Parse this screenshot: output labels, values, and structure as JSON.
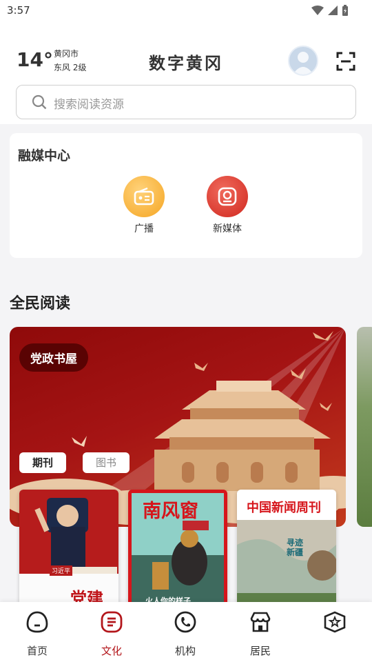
{
  "status": {
    "time": "3:57"
  },
  "header": {
    "temperature": "14°",
    "city": "黄冈市",
    "wind": "东风 2级",
    "app_title": "数字黄冈"
  },
  "search": {
    "placeholder": "搜索阅读资源"
  },
  "media_center": {
    "title": "融媒中心",
    "items": [
      {
        "label": "广播",
        "icon": "radio-icon",
        "color": "#f5b53c"
      },
      {
        "label": "新媒体",
        "icon": "camera-icon",
        "color": "#e33a2f"
      }
    ]
  },
  "reading": {
    "title": "全民阅读",
    "banner_tag": "党政书屋",
    "tabs": [
      "期刊",
      "图书"
    ],
    "covers": [
      {
        "title": "习近平",
        "subtitle": "党建"
      },
      {
        "title": "南风窗",
        "subtitle": "火人你的样子"
      },
      {
        "title": "中国新闻周刊",
        "subtitle": "寻迹新疆"
      }
    ]
  },
  "bottom_nav": {
    "items": [
      {
        "label": "首页",
        "icon": "home-icon",
        "active": false
      },
      {
        "label": "文化",
        "icon": "culture-icon",
        "active": true
      },
      {
        "label": "机构",
        "icon": "phone-icon",
        "active": false
      },
      {
        "label": "居民",
        "icon": "shop-icon",
        "active": false
      },
      {
        "label": "",
        "icon": "star-icon",
        "active": false
      }
    ]
  },
  "colors": {
    "accent": "#b3161b",
    "banner": "#a51414"
  }
}
